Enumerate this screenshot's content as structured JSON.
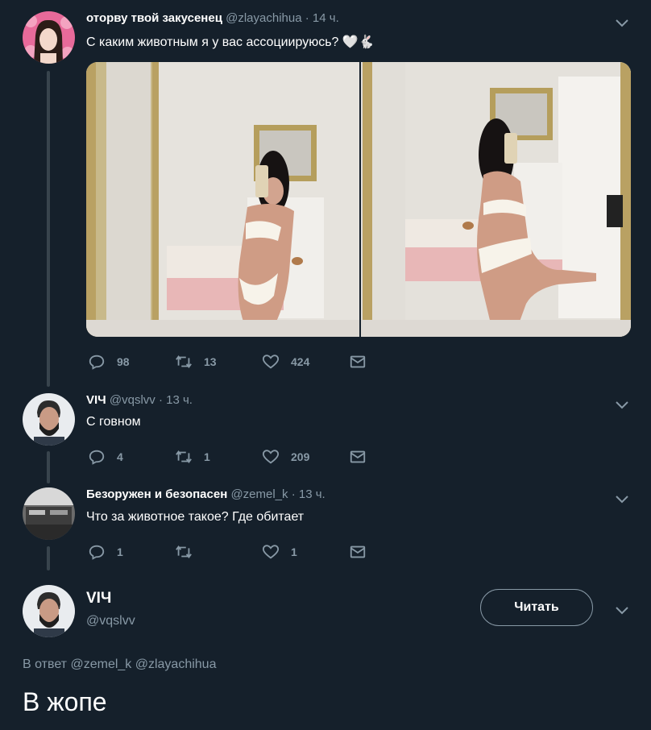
{
  "colors": {
    "background": "#15202b",
    "muted": "#8899a6",
    "thread_line": "#38444d",
    "text": "#ffffff"
  },
  "tweet1": {
    "name": "оторву твой закусенец",
    "handle": "@zlayachihua",
    "separator": "·",
    "time": "14 ч.",
    "text": "С каким животным я у вас ассоциируюсь? 🤍🐇",
    "replies": "98",
    "retweets": "13",
    "likes": "424"
  },
  "tweet2": {
    "name": "VIЧ",
    "handle": "@vqslvv",
    "separator": "·",
    "time": "13 ч.",
    "text": "С говном",
    "replies": "4",
    "retweets": "1",
    "likes": "209"
  },
  "tweet3": {
    "name": "Безоружен и безопасен",
    "handle": "@zemel_k",
    "separator": "·",
    "time": "13 ч.",
    "text": "Что за животное такое? Где обитает",
    "replies": "1",
    "retweets": "",
    "likes": "1"
  },
  "main_tweet": {
    "name": "VIЧ",
    "handle": "@vqslvv",
    "follow_label": "Читать",
    "reply_prefix": "В ответ",
    "reply_to": "@zemel_k @zlayachihua",
    "text": "В жопе"
  },
  "icons": [
    "reply-icon",
    "retweet-icon",
    "like-icon",
    "dm-icon",
    "chevron-down-icon"
  ]
}
